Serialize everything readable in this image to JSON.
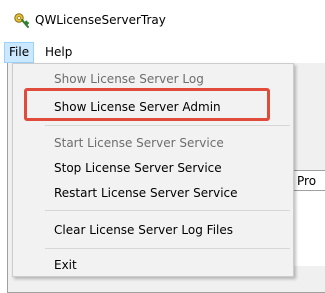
{
  "window": {
    "title": "QWLicenseServerTray",
    "icon": "key-icon"
  },
  "menubar": {
    "file_label": "File",
    "help_label": "Help"
  },
  "file_menu": {
    "items": [
      {
        "label": "Show License Server Log",
        "enabled": false
      },
      {
        "label": "Show License Server Admin",
        "enabled": true
      },
      {
        "label": "Start License Server Service",
        "enabled": false
      },
      {
        "label": "Stop License Server Service",
        "enabled": true
      },
      {
        "label": "Restart License Server Service",
        "enabled": true
      },
      {
        "label": "Clear License Server Log Files",
        "enabled": true
      },
      {
        "label": "Exit",
        "enabled": true
      }
    ]
  },
  "background_list": {
    "column_header": "Pro"
  },
  "colors": {
    "highlight_box": "#e14b3b",
    "menu_selected": "#cce8ff",
    "disabled_text": "#6d6d6d"
  }
}
